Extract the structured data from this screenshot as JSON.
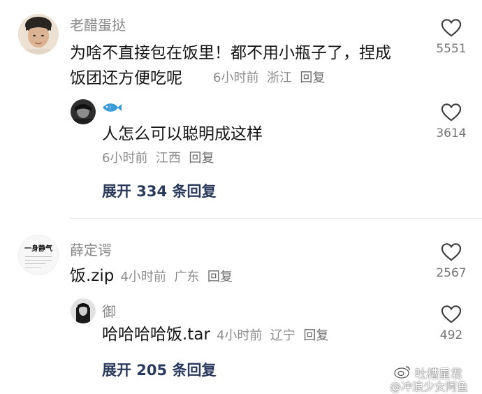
{
  "comments": [
    {
      "username": "老醋蛋挞",
      "text": "为啥不直接包在饭里！都不用小瓶子了，捏成饭团还方便吃呢",
      "time": "6小时前",
      "location": "浙江",
      "reply_label": "回复",
      "likes": "5551",
      "replies": [
        {
          "username": "🐟",
          "text": "人怎么可以聪明成这样",
          "time": "6小时前",
          "location": "江西",
          "reply_label": "回复",
          "likes": "3614"
        }
      ],
      "expand_label": "展开 334 条回复"
    },
    {
      "username": "薛定谔",
      "avatar_text": "一身静气",
      "text": "饭.zip",
      "time": "4小时前",
      "location": "广东",
      "reply_label": "回复",
      "likes": "2567",
      "replies": [
        {
          "username": "御",
          "text": "哈哈哈哈饭.tar",
          "time": "4小时前",
          "location": "辽宁",
          "reply_label": "回复",
          "likes": "492"
        }
      ],
      "expand_label": "展开 205 条回复"
    }
  ],
  "watermark": {
    "line1": "吐槽星君",
    "line2": "@冲浪少女阿鱼"
  },
  "icons": {
    "like": "heart-outline-icon",
    "watermark": "weibo-logo-icon"
  },
  "colors": {
    "expand_link": "#2a3a5c",
    "meta_text": "#8c8c8c",
    "username": "#8a8a8a",
    "reply_fish": "#3a9bd9"
  }
}
